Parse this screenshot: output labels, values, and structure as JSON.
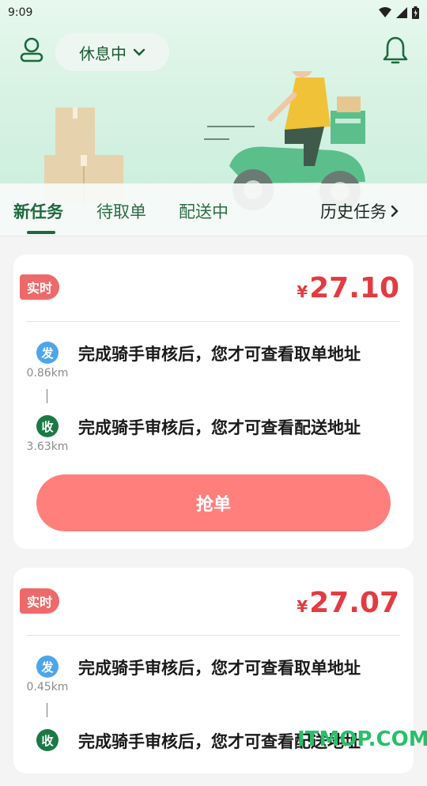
{
  "status_bar": {
    "time": "9:09"
  },
  "header": {
    "status_label": "休息中"
  },
  "tabs": [
    {
      "label": "新任务"
    },
    {
      "label": "待取单"
    },
    {
      "label": "配送中"
    },
    {
      "label": "历史任务"
    }
  ],
  "orders": [
    {
      "tag": "实时",
      "currency": "¥",
      "price": "27.10",
      "pickup": {
        "badge": "发",
        "distance": "0.86km",
        "text": "完成骑手审核后，您才可查看取单地址"
      },
      "dropoff": {
        "badge": "收",
        "distance": "3.63km",
        "text": "完成骑手审核后，您才可查看配送地址"
      },
      "action": "抢单"
    },
    {
      "tag": "实时",
      "currency": "¥",
      "price": "27.07",
      "pickup": {
        "badge": "发",
        "distance": "0.45km",
        "text": "完成骑手审核后，您才可查看取单地址"
      },
      "dropoff": {
        "badge": "收",
        "distance": "",
        "text": "完成骑手审核后，您才可查看配送地址"
      }
    }
  ],
  "watermark": "ITMOP.COM",
  "colors": {
    "primary": "#1c6a3c",
    "price": "#e33b41",
    "grab_button": "#ff7f7d",
    "tag": "#ee6a6a"
  }
}
